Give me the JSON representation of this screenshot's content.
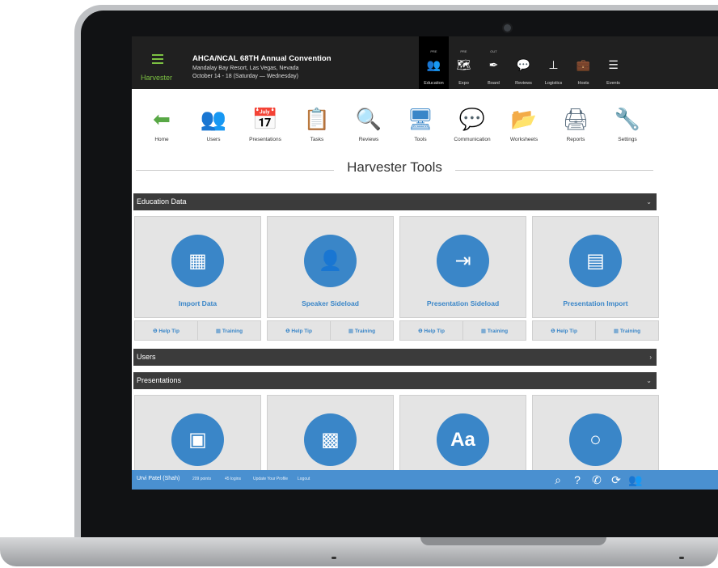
{
  "app": {
    "brand": "Harvester"
  },
  "event": {
    "title": "AHCA/NCAL 68TH Annual Convention",
    "venue": "Mandalay Bay Resort, Las Vegas, Nevada",
    "dates": "October 14 - 18 (Saturday — Wednesday)"
  },
  "nav": [
    {
      "pre": "PRE",
      "icon": "people-icon",
      "glyph": "👥",
      "label": "Education"
    },
    {
      "pre": "PRE",
      "icon": "map-icon",
      "glyph": "🗺",
      "label": "Expo"
    },
    {
      "pre": "OUT",
      "icon": "pen-icon",
      "glyph": "✒",
      "label": "Board"
    },
    {
      "pre": "",
      "icon": "chat-icon",
      "glyph": "💬",
      "label": "Reviews"
    },
    {
      "pre": "",
      "icon": "org-chart-icon",
      "glyph": "⊥",
      "label": "Logistics"
    },
    {
      "pre": "",
      "icon": "briefcase-icon",
      "glyph": "💼",
      "label": "Hosts"
    },
    {
      "pre": "",
      "icon": "list-icon",
      "glyph": "☰",
      "label": "Events"
    }
  ],
  "tools": [
    {
      "label": "Home",
      "icon": "home-arrow-icon",
      "glyph": "⬅",
      "color": "#58a845"
    },
    {
      "label": "Users",
      "icon": "users-icon",
      "glyph": "👥",
      "color": "#d0691e"
    },
    {
      "label": "Presentations",
      "icon": "calendar-clock-icon",
      "glyph": "📅",
      "color": "#c89a3c"
    },
    {
      "label": "Tasks",
      "icon": "checklist-icon",
      "glyph": "📋",
      "color": "#c03030"
    },
    {
      "label": "Reviews",
      "icon": "magnifier-icon",
      "glyph": "🔍",
      "color": "#9aa8b4"
    },
    {
      "label": "Tools",
      "icon": "monitor-icon",
      "glyph": "🖥",
      "color": "#3a86c8"
    },
    {
      "label": "Communication",
      "icon": "chat-bubble-icon",
      "glyph": "💬",
      "color": "#46a83a"
    },
    {
      "label": "Worksheets",
      "icon": "folders-icon",
      "glyph": "📂",
      "color": "#e8a82a"
    },
    {
      "label": "Reports",
      "icon": "printer-icon",
      "glyph": "🖨",
      "color": "#5d7081"
    },
    {
      "label": "Settings",
      "icon": "wrench-screwdriver-icon",
      "glyph": "🔧",
      "color": "#8b6e4a"
    }
  ],
  "page_title": "Harvester Tools",
  "sections": {
    "education": {
      "label": "Education Data",
      "chevron": "⌄"
    },
    "users": {
      "label": "Users",
      "chevron": "›"
    },
    "presentations": {
      "label": "Presentations",
      "chevron": "⌄"
    }
  },
  "education_cards": [
    {
      "title": "Import Data",
      "icon": "import-sheet-icon",
      "glyph": "▦"
    },
    {
      "title": "Speaker Sideload",
      "icon": "speaker-icon",
      "glyph": "👤"
    },
    {
      "title": "Presentation Sideload",
      "icon": "sign-in-icon",
      "glyph": "⇥"
    },
    {
      "title": "Presentation Import",
      "icon": "projector-icon",
      "glyph": "▤"
    }
  ],
  "card_footer": {
    "help": "❶ Help Tip",
    "training": "▦ Training"
  },
  "presentation_cards": [
    {
      "icon": "documents-icon",
      "glyph": "▣"
    },
    {
      "icon": "qr-code-icon",
      "glyph": "▩"
    },
    {
      "icon": "font-icon",
      "glyph": "Aa"
    },
    {
      "icon": "bubbles-icon",
      "glyph": "○"
    }
  ],
  "status": {
    "user": "Urvi Patel (Shah)",
    "points": "209 points",
    "logins": "45 logins",
    "update": "Update Your Profile",
    "logout": "Logout"
  }
}
